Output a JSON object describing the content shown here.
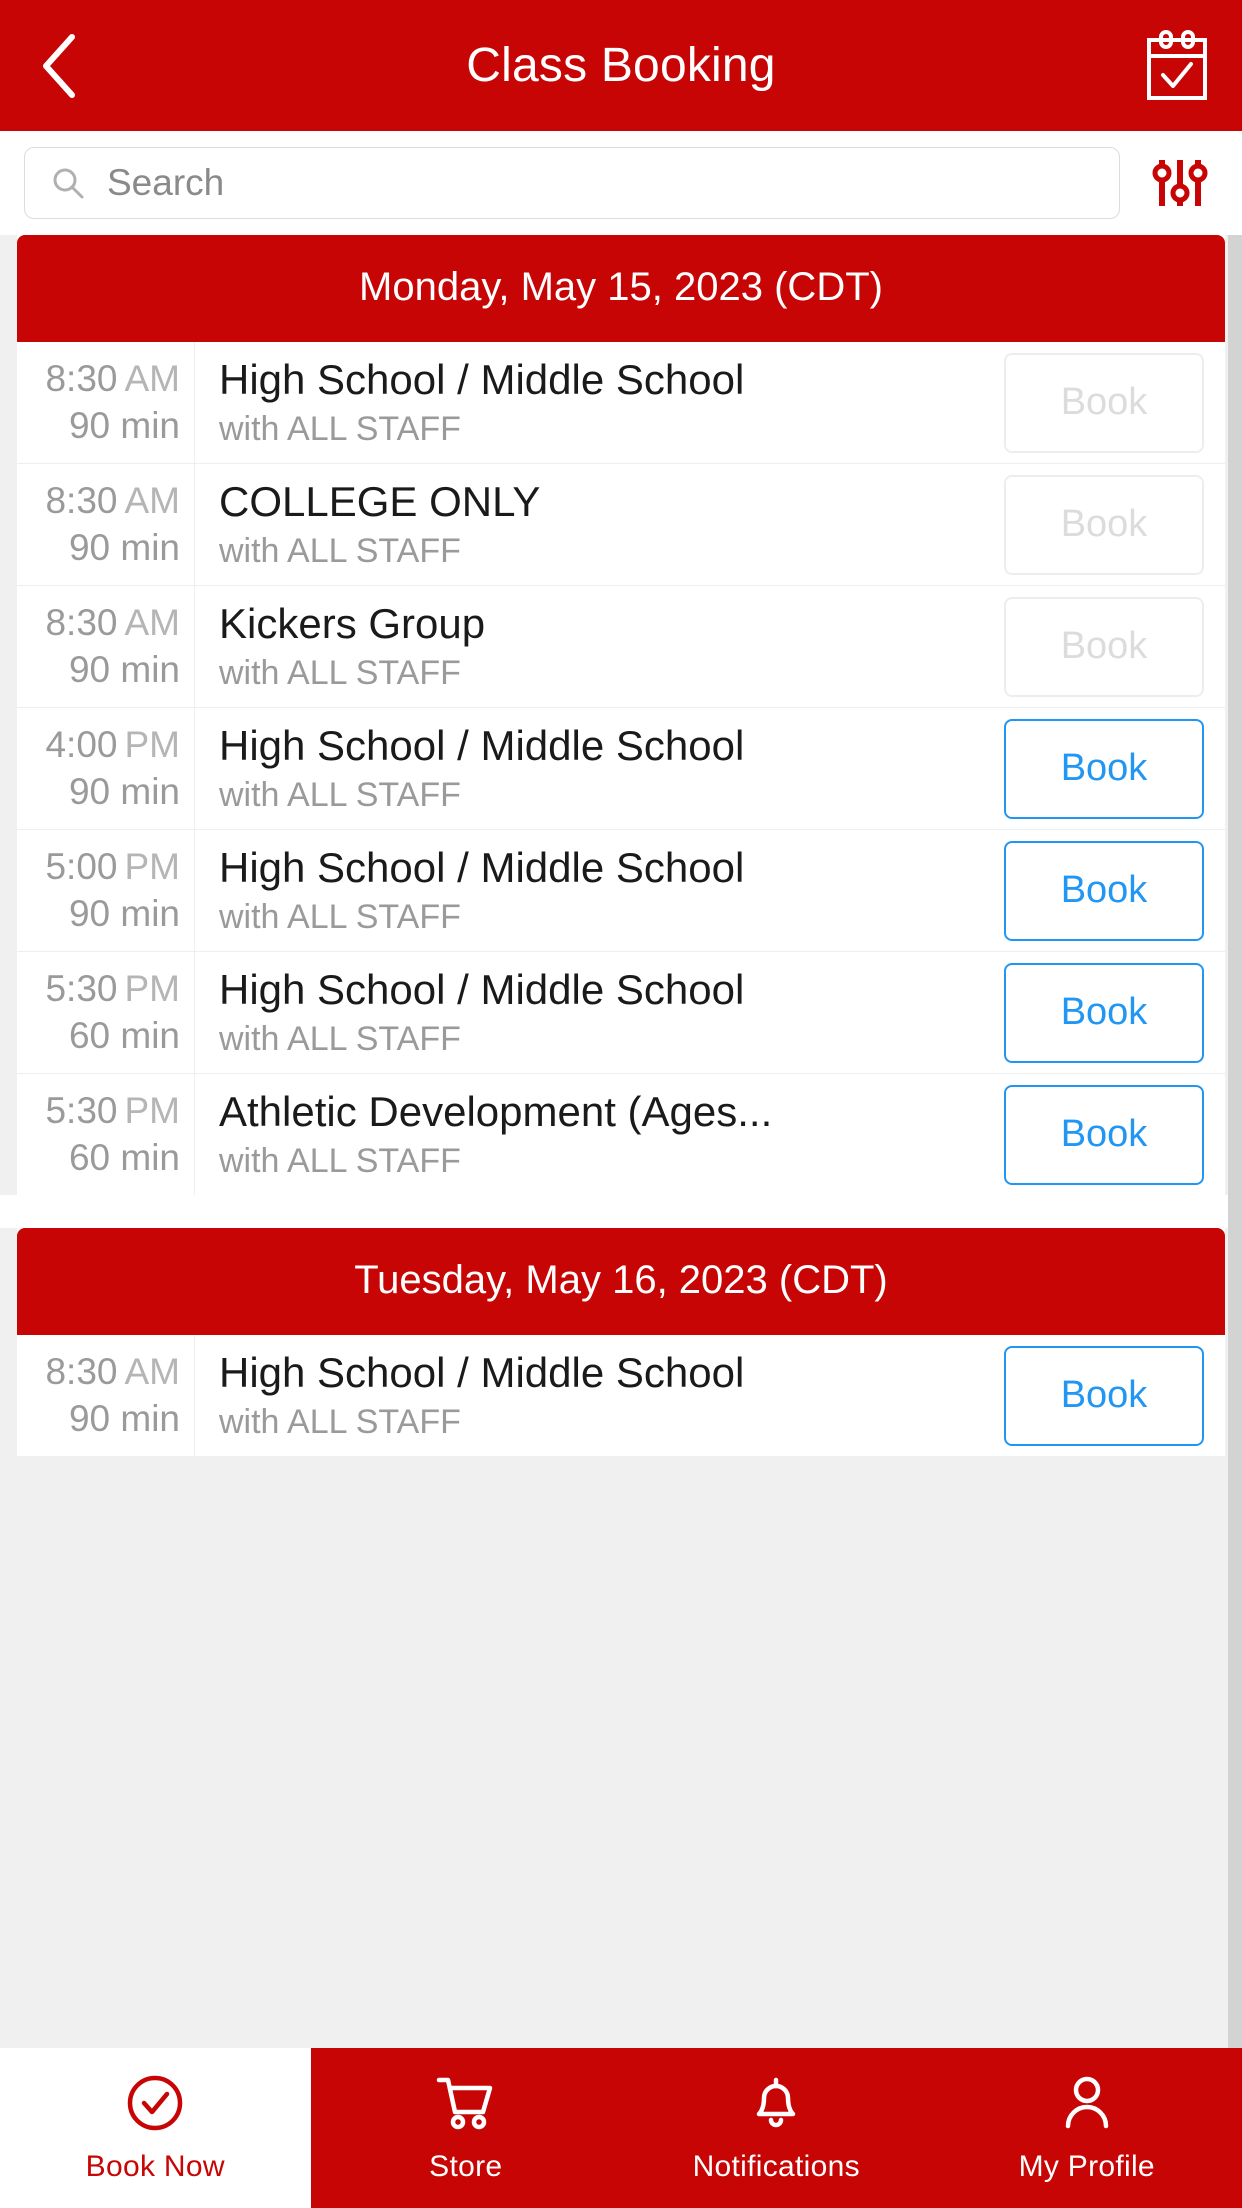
{
  "header": {
    "title": "Class Booking",
    "back_icon": "chevron-left-icon",
    "calendar_icon": "calendar-check-icon"
  },
  "search": {
    "placeholder": "Search",
    "value": "",
    "search_icon": "search-icon",
    "filter_icon": "sliders-filter-icon"
  },
  "days": [
    {
      "date_label": "Monday, May 15, 2023 (CDT)",
      "classes": [
        {
          "time": "8:30",
          "ampm": "AM",
          "duration": "90 min",
          "name": "High School / Middle School",
          "staff": "with ALL STAFF",
          "book_label": "Book",
          "enabled": false
        },
        {
          "time": "8:30",
          "ampm": "AM",
          "duration": "90 min",
          "name": "COLLEGE ONLY",
          "staff": "with ALL STAFF",
          "book_label": "Book",
          "enabled": false
        },
        {
          "time": "8:30",
          "ampm": "AM",
          "duration": "90 min",
          "name": "Kickers Group",
          "staff": "with ALL STAFF",
          "book_label": "Book",
          "enabled": false
        },
        {
          "time": "4:00",
          "ampm": "PM",
          "duration": "90 min",
          "name": "High School / Middle School",
          "staff": "with ALL STAFF",
          "book_label": "Book",
          "enabled": true
        },
        {
          "time": "5:00",
          "ampm": "PM",
          "duration": "90 min",
          "name": "High School / Middle School",
          "staff": "with ALL STAFF",
          "book_label": "Book",
          "enabled": true
        },
        {
          "time": "5:30",
          "ampm": "PM",
          "duration": "60 min",
          "name": "High School / Middle School",
          "staff": "with ALL STAFF",
          "book_label": "Book",
          "enabled": true
        },
        {
          "time": "5:30",
          "ampm": "PM",
          "duration": "60 min",
          "name": "Athletic Development (Ages...",
          "staff": "with ALL STAFF",
          "book_label": "Book",
          "enabled": true
        }
      ]
    },
    {
      "date_label": "Tuesday, May 16, 2023 (CDT)",
      "classes": [
        {
          "time": "8:30",
          "ampm": "AM",
          "duration": "90 min",
          "name": "High School / Middle School",
          "staff": "with ALL STAFF",
          "book_label": "Book",
          "enabled": true
        }
      ]
    }
  ],
  "tabbar": {
    "items": [
      {
        "label": "Book Now",
        "icon": "check-circle-icon",
        "active": true
      },
      {
        "label": "Store",
        "icon": "shopping-cart-icon",
        "active": false
      },
      {
        "label": "Notifications",
        "icon": "bell-icon",
        "active": false
      },
      {
        "label": "My Profile",
        "icon": "user-icon",
        "active": false
      }
    ]
  },
  "colors": {
    "brand_red": "#c80505",
    "accent_blue": "#2196f3",
    "disabled_grey": "#dcdcdc",
    "muted_text": "#9a9a9a"
  }
}
